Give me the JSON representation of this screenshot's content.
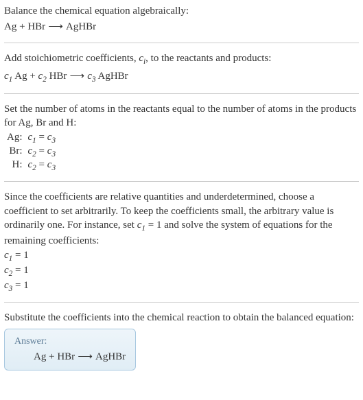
{
  "section1": {
    "title": "Balance the chemical equation algebraically:",
    "equation_parts": {
      "r1": "Ag",
      "plus": " + ",
      "r2": "HBr",
      "arrow": " ⟶ ",
      "p1": "AgHBr"
    }
  },
  "section2": {
    "intro_before": "Add stoichiometric coefficients, ",
    "ci": "c",
    "ci_sub": "i",
    "intro_after": ", to the reactants and products:",
    "eq": {
      "c1": "c",
      "c1s": "1",
      "sp1": " ",
      "r1": "Ag",
      "plus": " + ",
      "c2": "c",
      "c2s": "2",
      "sp2": " ",
      "r2": "HBr",
      "arrow": " ⟶ ",
      "c3": "c",
      "c3s": "3",
      "sp3": " ",
      "p1": "AgHBr"
    }
  },
  "section3": {
    "intro": "Set the number of atoms in the reactants equal to the number of atoms in the products for Ag, Br and H:",
    "rows": [
      {
        "label": "Ag:",
        "lhs_c": "c",
        "lhs_s": "1",
        "eq": " = ",
        "rhs_c": "c",
        "rhs_s": "3"
      },
      {
        "label": "Br:",
        "lhs_c": "c",
        "lhs_s": "2",
        "eq": " = ",
        "rhs_c": "c",
        "rhs_s": "3"
      },
      {
        "label": "H:",
        "lhs_c": "c",
        "lhs_s": "2",
        "eq": " = ",
        "rhs_c": "c",
        "rhs_s": "3"
      }
    ]
  },
  "section4": {
    "intro_a": "Since the coefficients are relative quantities and underdetermined, choose a coefficient to set arbitrarily. To keep the coefficients small, the arbitrary value is ordinarily one. For instance, set ",
    "cset": "c",
    "cset_s": "1",
    "intro_b": " = 1 and solve the system of equations for the remaining coefficients:",
    "lines": [
      {
        "c": "c",
        "s": "1",
        "rest": " = 1"
      },
      {
        "c": "c",
        "s": "2",
        "rest": " = 1"
      },
      {
        "c": "c",
        "s": "3",
        "rest": " = 1"
      }
    ]
  },
  "section5": {
    "intro": "Substitute the coefficients into the chemical reaction to obtain the balanced equation:",
    "answer_label": "Answer:",
    "answer": {
      "r1": "Ag",
      "plus": " + ",
      "r2": "HBr",
      "arrow": " ⟶ ",
      "p1": "AgHBr"
    }
  }
}
